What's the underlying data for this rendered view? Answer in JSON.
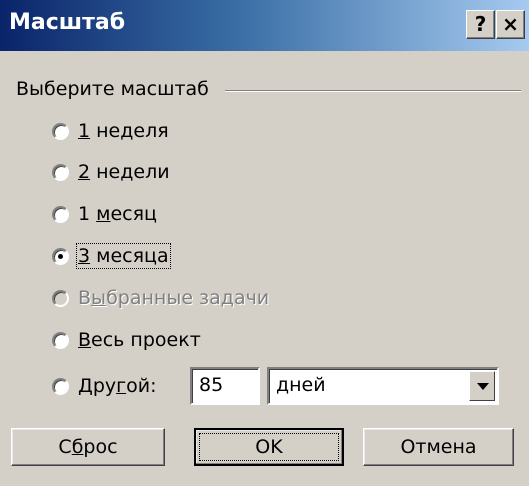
{
  "window": {
    "title": "Масштаб",
    "help_label": "?",
    "close_label": "×"
  },
  "group": {
    "label": "Выберите масштаб"
  },
  "options": [
    {
      "pre": "",
      "u": "1",
      "post": " неделя",
      "checked": false,
      "disabled": false
    },
    {
      "pre": "",
      "u": "2",
      "post": " недели",
      "checked": false,
      "disabled": false
    },
    {
      "pre": "1 ",
      "u": "м",
      "post": "есяц",
      "checked": false,
      "disabled": false
    },
    {
      "pre": "",
      "u": "3",
      "post": " месяца",
      "checked": true,
      "disabled": false
    },
    {
      "pre": "В",
      "u": "ы",
      "post": "бранные задачи",
      "checked": false,
      "disabled": true
    },
    {
      "pre": "",
      "u": "В",
      "post": "есь проект",
      "checked": false,
      "disabled": false
    },
    {
      "pre": "Дру",
      "u": "г",
      "post": "ой:",
      "checked": false,
      "disabled": false
    }
  ],
  "custom": {
    "value": "85",
    "unit": "дней"
  },
  "buttons": {
    "reset": {
      "pre": "С",
      "u": "б",
      "post": "рос"
    },
    "ok": "OK",
    "cancel": "Отмена"
  }
}
